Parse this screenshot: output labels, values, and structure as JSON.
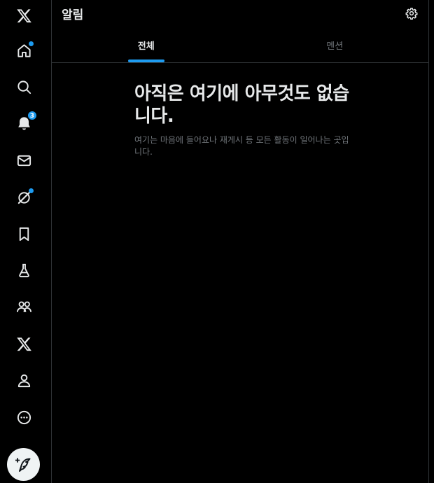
{
  "header": {
    "title": "알림",
    "settings_icon": "gear-icon"
  },
  "tabs": [
    {
      "label": "전체",
      "active": true
    },
    {
      "label": "멘션",
      "active": false
    }
  ],
  "empty_state": {
    "title": "아직은 여기에 아무것도 없습니다.",
    "description": "여기는 마음에 들어요나 재게시 등 모든 활동이 일어나는 곳입니다."
  },
  "nav": {
    "items": [
      {
        "icon": "x-logo-icon"
      },
      {
        "icon": "home-icon",
        "has_dot": true
      },
      {
        "icon": "search-icon"
      },
      {
        "icon": "bell-icon",
        "badge": "3"
      },
      {
        "icon": "mail-icon"
      },
      {
        "icon": "grok-icon",
        "has_dot": true
      },
      {
        "icon": "bookmark-icon"
      },
      {
        "icon": "flask-icon"
      },
      {
        "icon": "communities-icon"
      },
      {
        "icon": "premium-x-icon"
      },
      {
        "icon": "profile-icon"
      },
      {
        "icon": "more-icon"
      },
      {
        "icon": "compose-post-icon"
      }
    ]
  },
  "colors": {
    "accent": "#1d9bf0",
    "background": "#000000",
    "border": "#2f3336",
    "text_primary": "#e7e9ea",
    "text_secondary": "#71767b"
  }
}
